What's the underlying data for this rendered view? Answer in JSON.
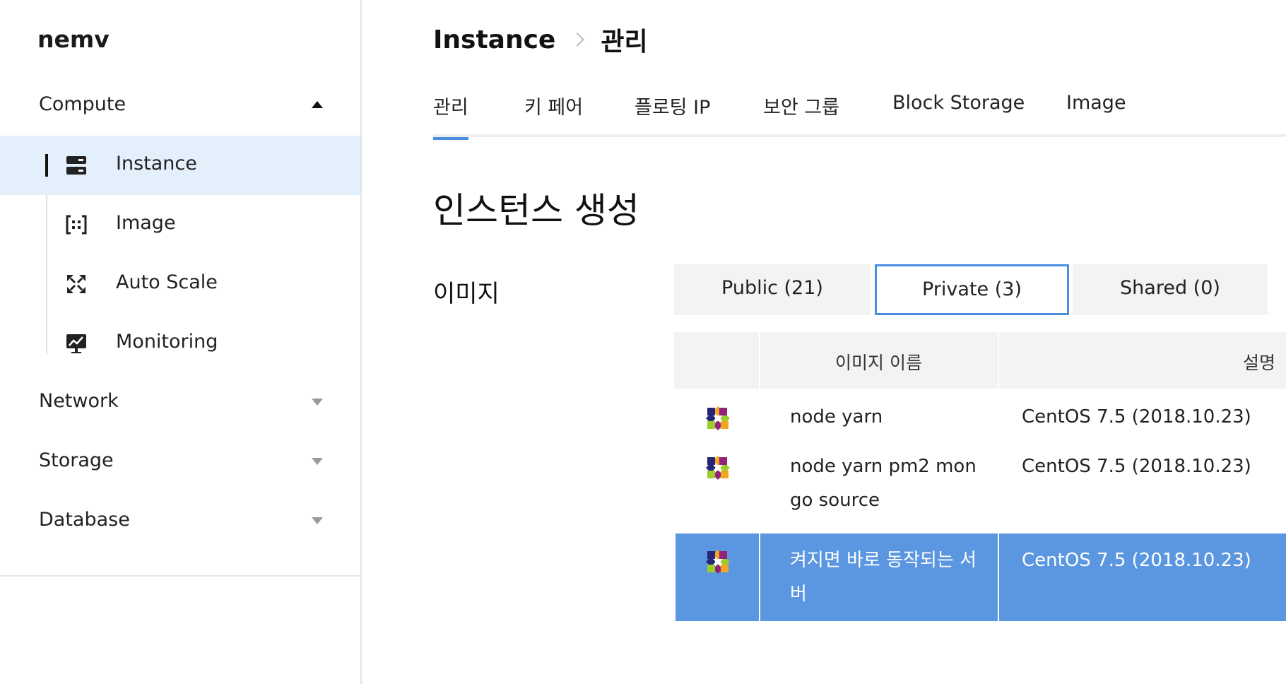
{
  "brand": "nemv",
  "sidebar": {
    "groups": [
      {
        "label": "Compute",
        "expanded": true
      },
      {
        "label": "Network",
        "expanded": false
      },
      {
        "label": "Storage",
        "expanded": false
      },
      {
        "label": "Database",
        "expanded": false
      }
    ],
    "compute_items": [
      {
        "label": "Instance",
        "icon": "server-icon",
        "active": true
      },
      {
        "label": "Image",
        "icon": "image-bracket-icon",
        "active": false
      },
      {
        "label": "Auto Scale",
        "icon": "expand-arrows-icon",
        "active": false
      },
      {
        "label": "Monitoring",
        "icon": "monitor-chart-icon",
        "active": false
      }
    ]
  },
  "breadcrumb": [
    "Instance",
    "관리"
  ],
  "tabs": [
    {
      "label": "관리",
      "active": true
    },
    {
      "label": "키 페어",
      "active": false
    },
    {
      "label": "플로팅 IP",
      "active": false
    },
    {
      "label": "보안 그룹",
      "active": false
    },
    {
      "label": "Block Storage",
      "active": false
    },
    {
      "label": "Image",
      "active": false
    }
  ],
  "page_title": "인스턴스 생성",
  "image_section": {
    "label": "이미지",
    "segments": [
      {
        "label": "Public (21)",
        "active": false
      },
      {
        "label": "Private (3)",
        "active": true
      },
      {
        "label": "Shared (0)",
        "active": false
      }
    ],
    "columns": {
      "name": "이미지 이름",
      "desc": "설명"
    },
    "rows": [
      {
        "name": "node yarn",
        "desc": "CentOS 7.5 (2018.10.23)",
        "icon": "centos-logo-icon",
        "selected": false
      },
      {
        "name": "node yarn pm2 mongo source",
        "desc": "CentOS 7.5 (2018.10.23)",
        "icon": "centos-logo-icon",
        "selected": false
      },
      {
        "name": "켜지면 바로 동작되는 서버",
        "desc": "CentOS 7.5 (2018.10.23)",
        "icon": "centos-logo-icon",
        "selected": true
      }
    ]
  },
  "colors": {
    "accent": "#4a8fe0",
    "selected_row": "#5b96e0",
    "active_nav_bg": "#e4effc",
    "header_bg": "#f3f3f3"
  }
}
